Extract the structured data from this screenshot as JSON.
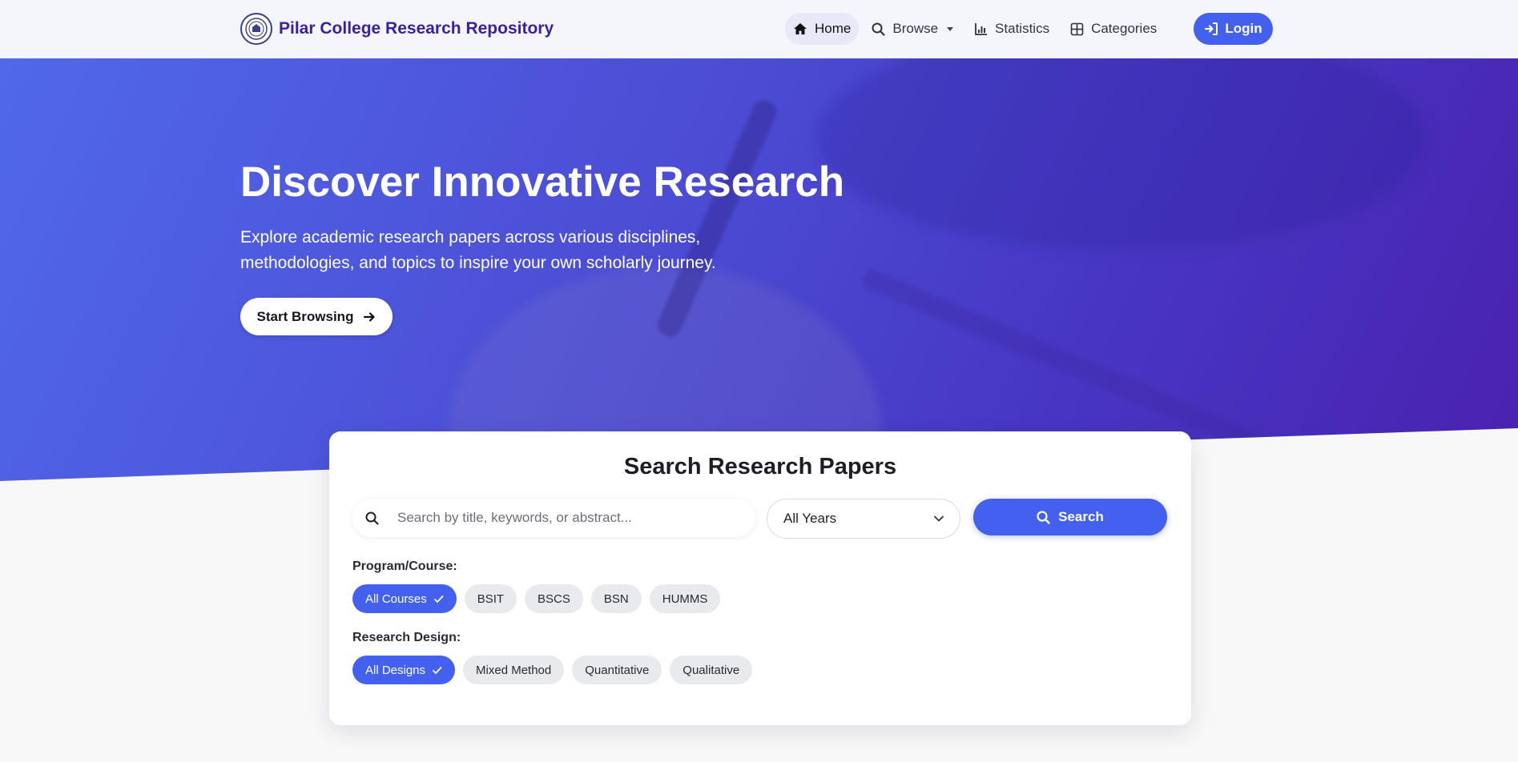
{
  "navbar": {
    "brand": "Pilar College Research Repository",
    "logo_icon": "college-seal-icon",
    "items": [
      {
        "label": "Home",
        "icon": "home-icon",
        "active": true
      },
      {
        "label": "Browse",
        "icon": "search-icon",
        "dropdown": true
      },
      {
        "label": "Statistics",
        "icon": "bar-chart-icon"
      },
      {
        "label": "Categories",
        "icon": "grid-icon"
      }
    ],
    "login_label": "Login"
  },
  "hero": {
    "title": "Discover Innovative Research",
    "subtitle": "Explore academic research papers across various disciplines, methodologies, and topics to inspire your own scholarly journey.",
    "cta_label": "Start Browsing"
  },
  "search": {
    "title": "Search Research Papers",
    "placeholder": "Search by title, keywords, or abstract...",
    "value": "",
    "year_selected": "All Years",
    "button_label": "Search"
  },
  "filters": {
    "program_label": "Program/Course:",
    "programs": [
      {
        "label": "All Courses",
        "active": true
      },
      {
        "label": "BSIT",
        "active": false
      },
      {
        "label": "BSCS",
        "active": false
      },
      {
        "label": "BSN",
        "active": false
      },
      {
        "label": "HUMMS",
        "active": false
      }
    ],
    "design_label": "Research Design:",
    "designs": [
      {
        "label": "All Designs",
        "active": true
      },
      {
        "label": "Mixed Method",
        "active": false
      },
      {
        "label": "Quantitative",
        "active": false
      },
      {
        "label": "Qualitative",
        "active": false
      }
    ]
  },
  "colors": {
    "accent": "#4361ee",
    "brand_text": "#3b1f9e",
    "hero_start": "#5068ea",
    "hero_end": "#4a21b0"
  }
}
